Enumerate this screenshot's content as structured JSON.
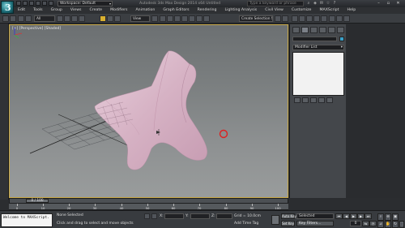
{
  "title_bar": {
    "app_logo_letter": "3",
    "workspace": "Workspace: Default",
    "title": "Autodesk 3ds Max Design 2014 x64    Untitled",
    "search_placeholder": "Type a keyword or phrase"
  },
  "menu": [
    "Edit",
    "Tools",
    "Group",
    "Views",
    "Create",
    "Modifiers",
    "Animation",
    "Graph Editors",
    "Rendering",
    "Lighting Analysis",
    "Civil View",
    "Customize",
    "MAXScript",
    "Help"
  ],
  "toolbar": {
    "filter": "All",
    "view": "View",
    "selection_set": "Create Selection Se"
  },
  "viewport": {
    "label": "[+] [Perspective] [Shaded]"
  },
  "command_panel": {
    "modifier_list": "Modifier List"
  },
  "timeline": {
    "frame_range": "0 / 100",
    "ticks": [
      "0",
      "10",
      "20",
      "30",
      "40",
      "50",
      "60",
      "70",
      "80",
      "90",
      "100"
    ]
  },
  "status": {
    "maxscript": "Welcome to MAXScript.",
    "selection": "None Selected",
    "prompt": "Click and drag to select and move objects",
    "x_label": "X:",
    "y_label": "Y:",
    "z_label": "Z:",
    "grid": "Grid = 10.0cm",
    "add_time_tag": "Add Time Tag",
    "auto_key": "Auto Key",
    "set_key": "Set Key",
    "selected": "Selected",
    "key_filters": "Key Filters...",
    "current_frame": "0"
  },
  "colors": {
    "surface": "#d9b8c8",
    "viewport_border": "#c8a845",
    "marker": "#e02020"
  }
}
